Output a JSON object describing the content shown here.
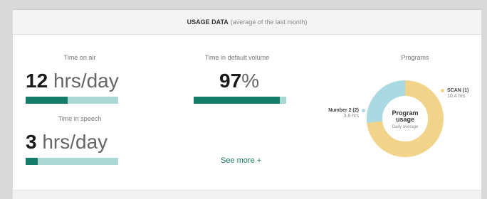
{
  "header": {
    "title": "USAGE DATA",
    "subtitle": "(average of the last month)"
  },
  "time_on_air": {
    "label": "Time on air",
    "value": "12",
    "unit": "hrs/day",
    "fill": 0.45
  },
  "time_in_speech": {
    "label": "Time in speech",
    "value": "3",
    "unit": "hrs/day",
    "fill": 0.13
  },
  "default_volume": {
    "label": "Time in default volume",
    "value": "97",
    "unit": "%",
    "fill": 0.93
  },
  "see_more": {
    "label": "See more +"
  },
  "programs": {
    "label": "Programs",
    "center_title": "Program usage",
    "center_sub": "Daily average",
    "items": [
      {
        "name": "SCAN (1)",
        "value": "10.4 hrs",
        "hours": 10.4,
        "color": "#f1d389"
      },
      {
        "name": "Number 2 (2)",
        "value": "3.8 hrs",
        "hours": 3.8,
        "color": "#a9d9e2"
      }
    ]
  }
}
